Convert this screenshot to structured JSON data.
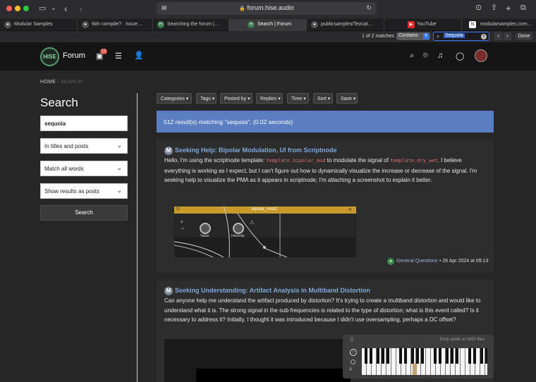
{
  "browser": {
    "url": "forum.hise.audio",
    "tabs": [
      {
        "label": "Modular Samples",
        "icon": "github-icon"
      },
      {
        "label": "Win compile? · Issue…",
        "icon": "github-icon"
      },
      {
        "label": "Searching the forum |…",
        "icon": "hise-icon"
      },
      {
        "label": "Search | Forum",
        "icon": "hise-icon"
      },
      {
        "label": "publicsamples/Tezcat…",
        "icon": "github-icon"
      },
      {
        "label": "YouTube",
        "icon": "youtube-icon"
      },
      {
        "label": "modularsamples.com…",
        "icon": "notion-icon"
      }
    ],
    "findbar": {
      "matches": "1 of 2 matches",
      "mode": "Contains",
      "query": "Sequoia",
      "done_label": "Done"
    }
  },
  "site": {
    "brand": "Forum",
    "logo_text": "HISE",
    "notification_count": "13"
  },
  "breadcrumb": {
    "home": "HOME",
    "separator": "/",
    "current": "SEARCH"
  },
  "sidebar": {
    "heading": "Search",
    "query": "sequoia",
    "in_option": "In titles and posts",
    "match_option": "Match all words",
    "show_option": "Show results as posts",
    "search_button": "Search"
  },
  "filters": [
    "Categories ▾",
    "Tags ▾",
    "Posted by ▾",
    "Replies ▾",
    "Time ▾",
    "Sort ▾",
    "Save ▾"
  ],
  "results_banner": "512 result(s) matching \"sequoia\", (0.02 seconds)",
  "posts": [
    {
      "avatar": "M",
      "title": "Seeking Help: Bipolar Modulation, UI from Scriptnode",
      "text_a": "Hello, I'm using the scriptnode template: ",
      "code_a": "template.bipolar_mod",
      "text_b": " to modulate the signal of",
      "code_b": "template.dry_wet",
      "text_c": ". I believe everything is working as I expect, but I can't figure out how to dynamically visualize the increase or decrease of the signal. I'm seeking help to visualize the PMA as it appears in scriptnode; I'm attaching a screenshot to explain it better.",
      "node_name": "bipolar_mod1",
      "knob_labels": [
        "Value",
        "Intensity"
      ],
      "category": "General Questions",
      "date": "• 26 Apr 2024 at 09:13"
    },
    {
      "avatar": "M",
      "title": "Seeking Understanding: Artifact Analysis in Multiband Distortion",
      "text": "Can anyone help me understand the artifact produced by distortion? It's trying to create a multiband distortion and would like to understand what it is. The strong signal in the sub-frequencies is related to the type of distortion; what is this event called? Is it necessary to address it? Initially, I thought it was introduced because I didn't use oversampling, perhaps a DC offset?",
      "keyboard_hint": "Drop audio or MIDI files"
    }
  ],
  "colors": {
    "accent": "#5b7ec2",
    "link": "#7fa8d8",
    "code": "#e06c75",
    "nodebar": "#c79a2a"
  }
}
